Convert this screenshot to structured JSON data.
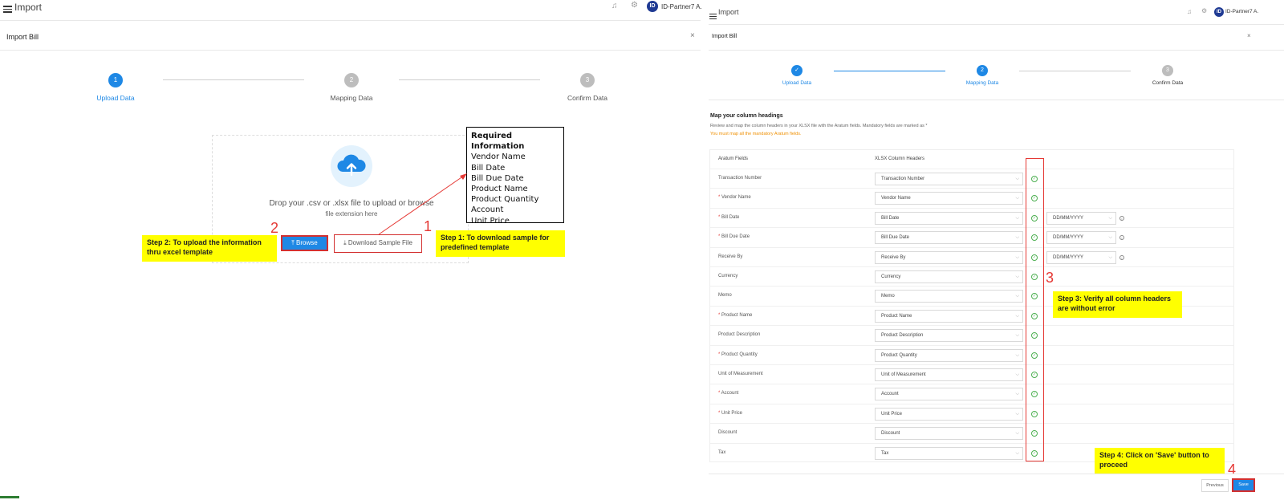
{
  "left": {
    "app_title": "Import",
    "user_name": "ID-Partner7 A.",
    "dialog_title": "Import Bill",
    "close": "×",
    "steps": [
      {
        "num": "1",
        "label": "Upload Data"
      },
      {
        "num": "2",
        "label": "Mapping Data"
      },
      {
        "num": "3",
        "label": "Confirm Data"
      }
    ],
    "drop_text": "Drop your .csv or .xlsx file to upload or browse",
    "drop_sub": "file extension here",
    "browse_label": "⤒ Browse",
    "download_label": "⤓ Download Sample File",
    "required_title": "Required Information",
    "required_items": [
      "Vendor Name",
      "Bill Date",
      "Bill Due Date",
      "Product Name",
      "Product Quantity",
      "Account",
      "Unit Price"
    ],
    "note_step1": "Step 1: To download sample for predefined template",
    "note_step2": "Step 2: To upload the information thru excel template",
    "num1": "1",
    "num2": "2"
  },
  "right": {
    "app_title": "Import",
    "user_name": "ID-Partner7 A.",
    "dialog_title": "Import Bill",
    "close": "×",
    "steps": [
      {
        "num": "✓",
        "label": "Upload Data"
      },
      {
        "num": "2",
        "label": "Mapping Data"
      },
      {
        "num": "3",
        "label": "Confirm Data"
      }
    ],
    "section_title": "Map your column headings",
    "section_desc": "Review and map the column headers in your XLSX file with the Aratum fields. Mandatory fields are marked as *",
    "section_warn": "You must map all the mandatory Aratum fields.",
    "col_fields": "Aratum Fields",
    "col_headers": "XLSX Column Headers",
    "rows": [
      {
        "field": "Transaction Number",
        "required": false,
        "value": "Transaction Number",
        "date_format": ""
      },
      {
        "field": "Vendor Name",
        "required": true,
        "value": "Vendor Name",
        "date_format": ""
      },
      {
        "field": "Bill Date",
        "required": true,
        "value": "Bill Date",
        "date_format": "DD/MM/YYYY"
      },
      {
        "field": "Bill Due Date",
        "required": true,
        "value": "Bill Due Date",
        "date_format": "DD/MM/YYYY"
      },
      {
        "field": "Receive By",
        "required": false,
        "value": "Receive By",
        "date_format": "DD/MM/YYYY"
      },
      {
        "field": "Currency",
        "required": false,
        "value": "Currency",
        "date_format": ""
      },
      {
        "field": "Memo",
        "required": false,
        "value": "Memo",
        "date_format": ""
      },
      {
        "field": "Product Name",
        "required": true,
        "value": "Product Name",
        "date_format": ""
      },
      {
        "field": "Product Description",
        "required": false,
        "value": "Product Description",
        "date_format": ""
      },
      {
        "field": "Product Quantity",
        "required": true,
        "value": "Product Quantity",
        "date_format": ""
      },
      {
        "field": "Unit of Measurement",
        "required": false,
        "value": "Unit of Measurement",
        "date_format": ""
      },
      {
        "field": "Account",
        "required": true,
        "value": "Account",
        "date_format": ""
      },
      {
        "field": "Unit Price",
        "required": true,
        "value": "Unit Price",
        "date_format": ""
      },
      {
        "field": "Discount",
        "required": false,
        "value": "Discount",
        "date_format": ""
      },
      {
        "field": "Tax",
        "required": false,
        "value": "Tax",
        "date_format": ""
      }
    ],
    "note_step3": "Step 3: Verify all column headers are without error",
    "note_step4": "Step 4: Click on 'Save' button to proceed",
    "num3": "3",
    "num4": "4",
    "prev_label": "Previous",
    "save_label": "Save"
  },
  "colors": {
    "primary": "#1e88e5",
    "annotation_red": "#e53935",
    "highlight_yellow": "#ffff00",
    "success_green": "#4caf50"
  }
}
